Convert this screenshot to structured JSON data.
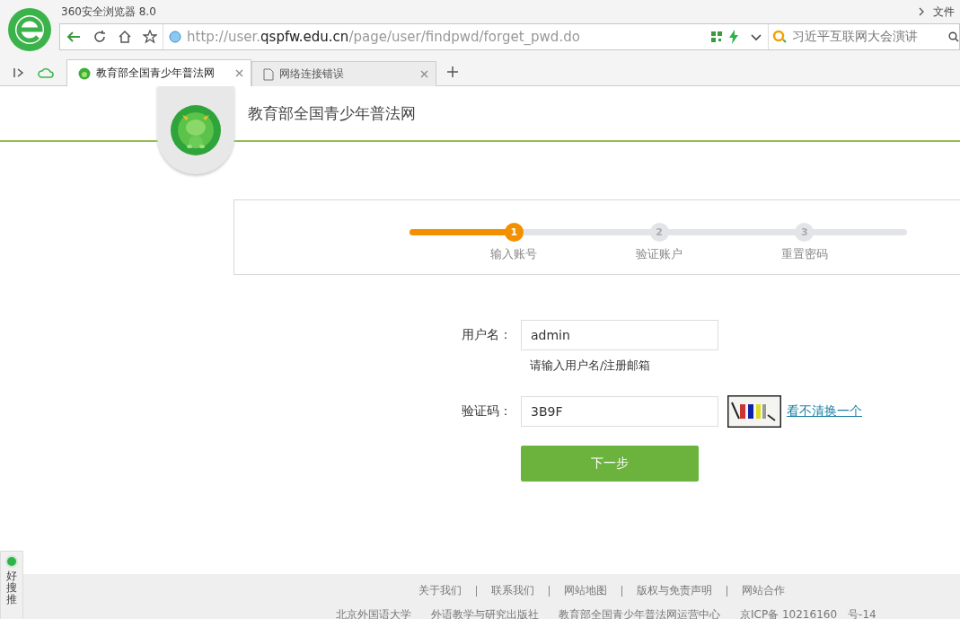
{
  "browser": {
    "title": "360安全浏览器 8.0",
    "menu_label": "文件",
    "url_prefix": "http://user.",
    "url_domain": "qspfw.edu.cn",
    "url_path": "/page/user/findpwd/forget_pwd.do",
    "search_value": "习近平互联网大会演讲"
  },
  "tabs": [
    {
      "label": "教育部全国青少年普法网",
      "selected": true
    },
    {
      "label": "网络连接错误",
      "selected": false
    }
  ],
  "site": {
    "title": "教育部全国青少年普法网"
  },
  "steps": {
    "level": 0.21,
    "items": [
      {
        "number": "1",
        "label": "输入账号",
        "selected": true
      },
      {
        "number": "2",
        "label": "验证账户",
        "selected": false
      },
      {
        "number": "3",
        "label": "重置密码",
        "selected": false
      }
    ]
  },
  "form": {
    "username_label": "用户名：",
    "username_value": "admin",
    "username_hint": "请输入用户名/注册邮箱",
    "captcha_label": "验证码：",
    "captcha_value": "3B9F",
    "refresh_link": "看不清换一个",
    "submit": "下一步"
  },
  "footer": {
    "links": [
      "关于我们",
      "联系我们",
      "网站地图",
      "版权与免责声明",
      "网站合作"
    ],
    "credits": [
      "北京外国语大学",
      "外语教学与研究出版社",
      "教育部全国青少年普法网运营中心",
      "京ICP备 10216160　号-14"
    ]
  },
  "side_widget": {
    "label": "好搜推"
  }
}
